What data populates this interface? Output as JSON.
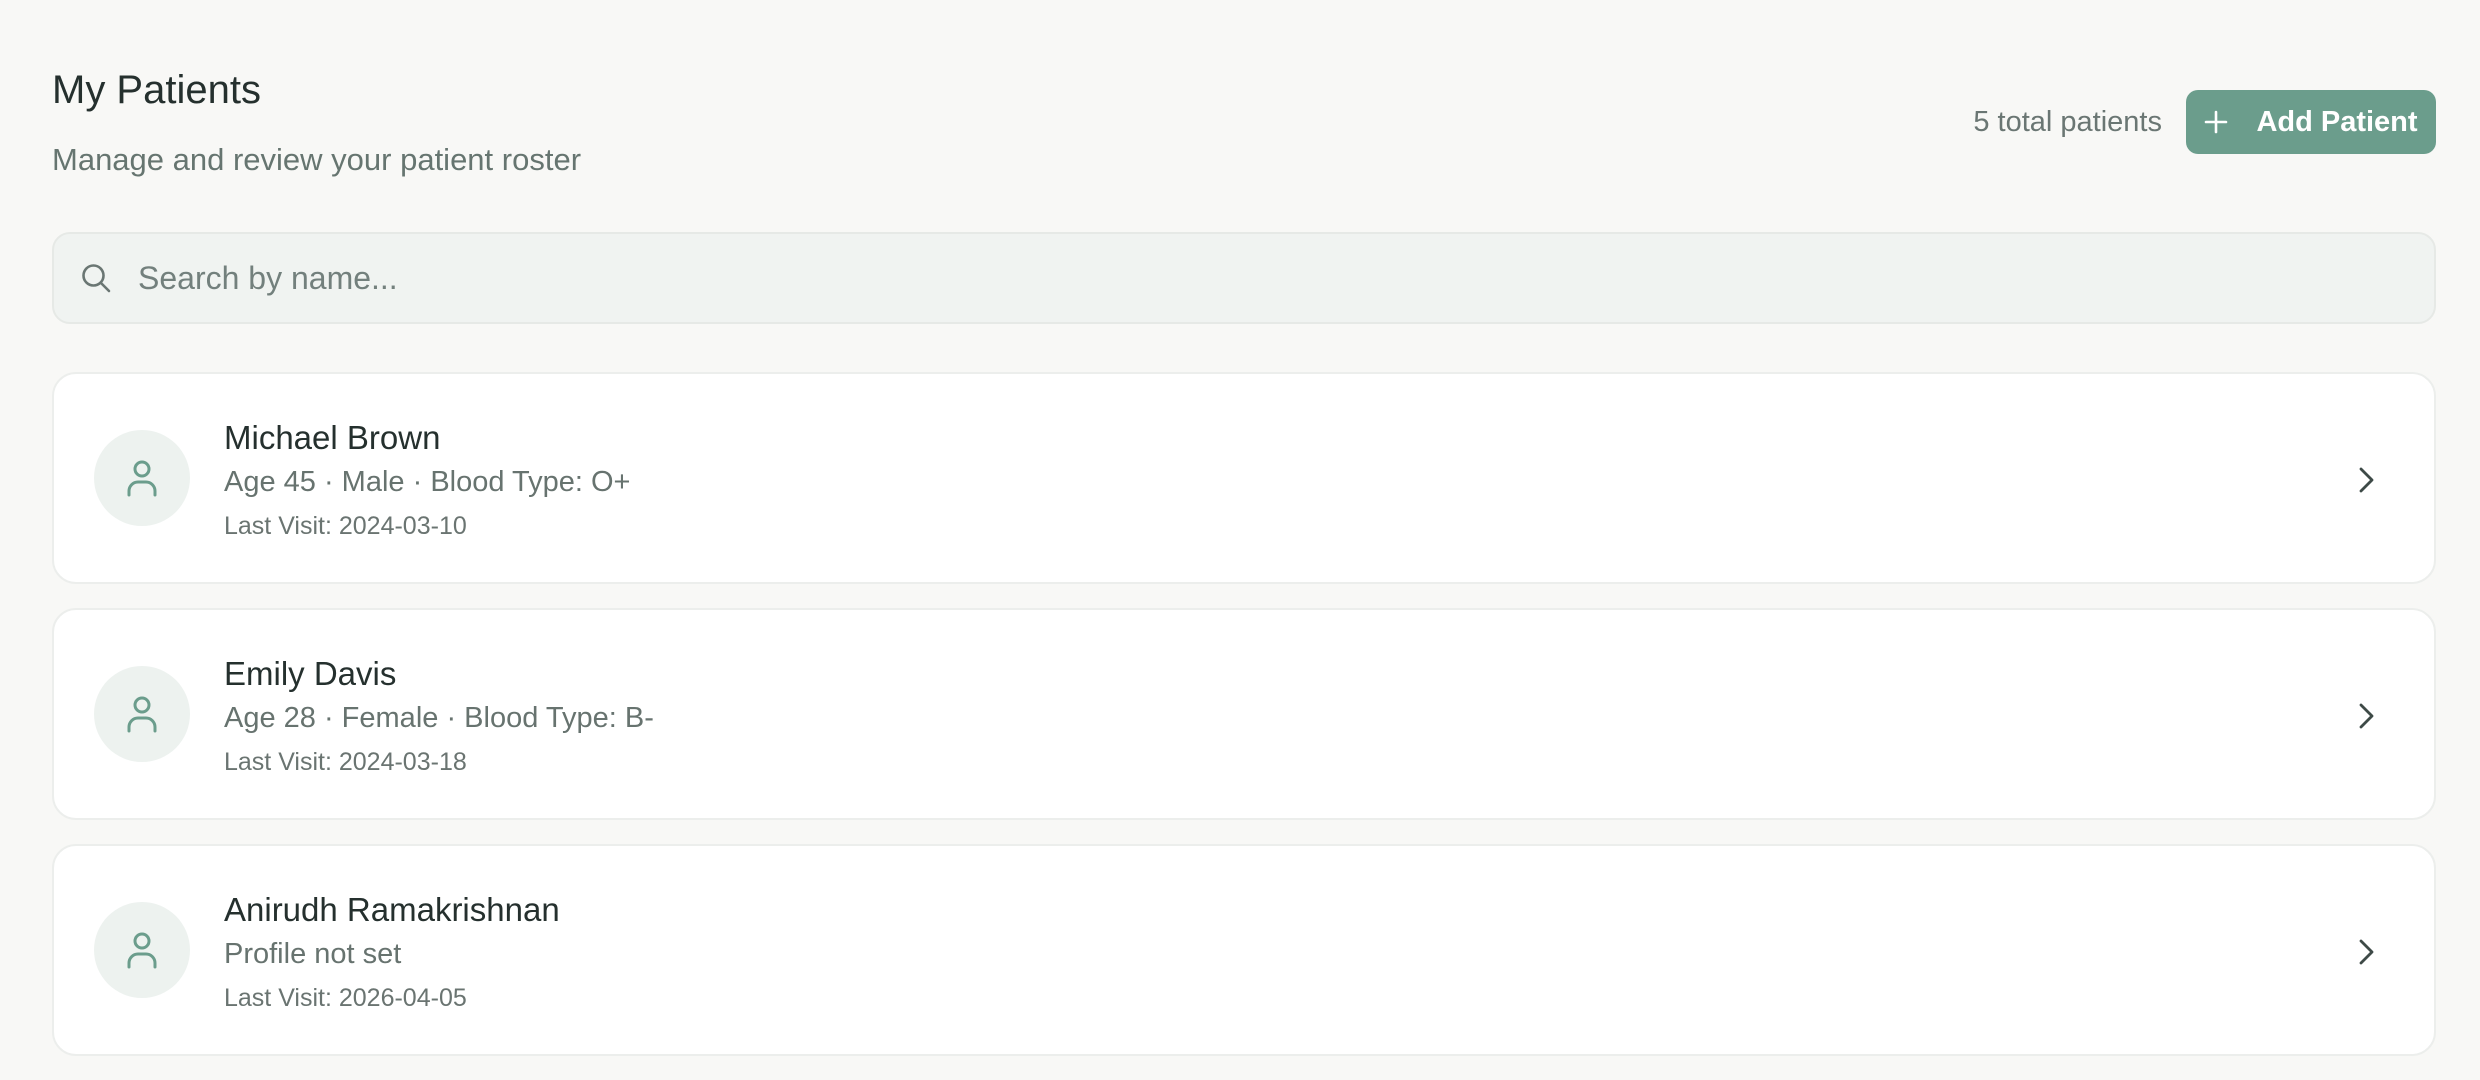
{
  "header": {
    "title": "My Patients",
    "subtitle": "Manage and review your patient roster",
    "total_label": "5 total patients",
    "add_label": "Add Patient"
  },
  "search": {
    "placeholder": "Search by name...",
    "value": ""
  },
  "patients": [
    {
      "name": "Michael Brown",
      "details": "Age 45 · Male · Blood Type: O+",
      "last_visit": "Last Visit: 2024-03-10"
    },
    {
      "name": "Emily Davis",
      "details": "Age 28 · Female · Blood Type: B-",
      "last_visit": "Last Visit: 2024-03-18"
    },
    {
      "name": "Anirudh Ramakrishnan",
      "details": "Profile not set",
      "last_visit": "Last Visit: 2026-04-05"
    }
  ],
  "icons": {
    "search": "search-icon",
    "add": "plus-icon",
    "avatar": "user-icon",
    "chevron": "chevron-right-icon"
  },
  "colors": {
    "accent": "#6b9d8c",
    "background": "#f8f8f6",
    "card": "#ffffff"
  }
}
